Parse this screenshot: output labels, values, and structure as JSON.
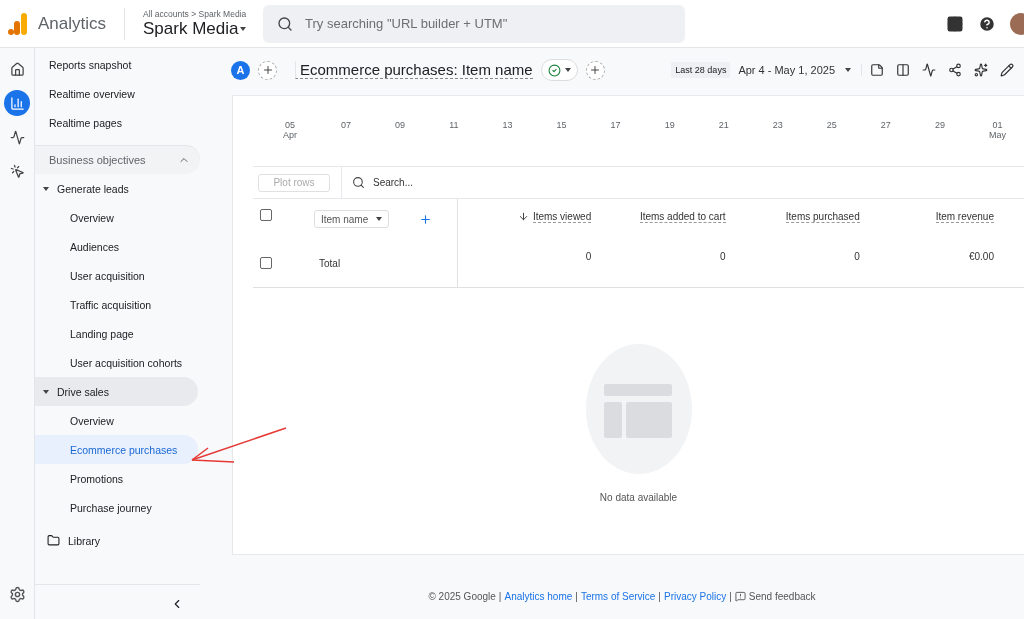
{
  "app": {
    "name": "Analytics",
    "breadcrumb": "All accounts > Spark Media",
    "account": "Spark Media"
  },
  "search": {
    "placeholder": "Try searching \"URL builder + UTM\""
  },
  "rail": [
    {
      "kind": "home",
      "selected": false
    },
    {
      "kind": "reports",
      "selected": true
    },
    {
      "kind": "explore",
      "selected": false
    },
    {
      "kind": "advertising",
      "selected": false
    }
  ],
  "sidebar": {
    "items": [
      {
        "label": "Reports snapshot",
        "selected": false
      },
      {
        "label": "Realtime overview",
        "selected": false
      },
      {
        "label": "Realtime pages",
        "selected": false
      }
    ],
    "section": {
      "label": "Business objectives",
      "expanded": true,
      "children": [
        {
          "label": "Generate leads",
          "expanded": true,
          "selected": false,
          "children": [
            {
              "label": "Overview",
              "selected": false
            },
            {
              "label": "Audiences",
              "selected": false
            },
            {
              "label": "User acquisition",
              "selected": false
            },
            {
              "label": "Traffic acquisition",
              "selected": false
            },
            {
              "label": "Landing page",
              "selected": false
            },
            {
              "label": "User acquisition cohorts",
              "selected": false
            }
          ]
        },
        {
          "label": "Drive sales",
          "expanded": true,
          "selected": true,
          "children": [
            {
              "label": "Overview",
              "selected": false
            },
            {
              "label": "Ecommerce purchases",
              "selected": true
            },
            {
              "label": "Promotions",
              "selected": false
            },
            {
              "label": "Purchase journey",
              "selected": false
            }
          ]
        }
      ]
    },
    "library": "Library"
  },
  "report": {
    "comparison_badge": "A",
    "title": "Ecommerce purchases: Item name",
    "date_preset": "Last 28 days",
    "date_range": "Apr 4 - May 1, 2025"
  },
  "timeline_ticks": [
    {
      "day": "05",
      "month": "Apr"
    },
    {
      "day": "07"
    },
    {
      "day": "09"
    },
    {
      "day": "11"
    },
    {
      "day": "13"
    },
    {
      "day": "15"
    },
    {
      "day": "17"
    },
    {
      "day": "19"
    },
    {
      "day": "21"
    },
    {
      "day": "23"
    },
    {
      "day": "25"
    },
    {
      "day": "27"
    },
    {
      "day": "29"
    },
    {
      "day": "01",
      "month": "May"
    }
  ],
  "table": {
    "plot_rows": "Plot rows",
    "search_placeholder": "Search...",
    "dimension": "Item name",
    "columns": [
      {
        "label": "Items viewed",
        "sorted": true
      },
      {
        "label": "Items added to cart",
        "sorted": false
      },
      {
        "label": "Items purchased",
        "sorted": false
      },
      {
        "label": "Item revenue",
        "sorted": false
      }
    ],
    "rows": [
      {
        "label": "Total",
        "checked": false,
        "values": [
          "0",
          "0",
          "0",
          "€0.00"
        ]
      }
    ],
    "header_checked": false
  },
  "empty_state": "No data available",
  "footer": {
    "copyright": "© 2025 Google",
    "separator": "|",
    "links": [
      "Analytics home",
      "Terms of Service",
      "Privacy Policy"
    ],
    "feedback": "Send feedback"
  }
}
